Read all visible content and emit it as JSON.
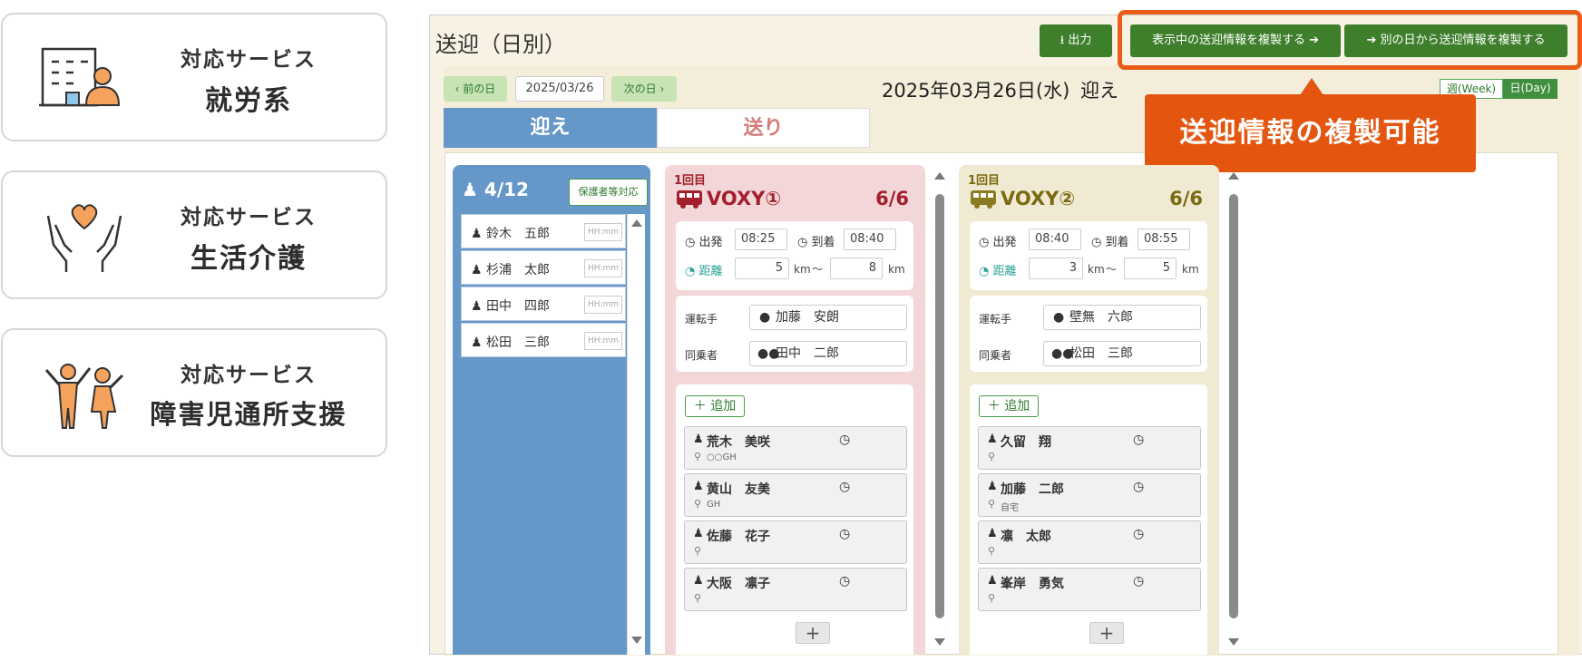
{
  "services": [
    {
      "label": "対応サービス",
      "name": "就労系",
      "icon": "office-worker-icon"
    },
    {
      "label": "対応サービス",
      "name": "生活介護",
      "icon": "care-hands-heart-icon"
    },
    {
      "label": "対応サービス",
      "name": "障害児通所支援",
      "icon": "children-icon"
    }
  ],
  "app": {
    "title": "送迎（日別）",
    "output_btn": "出力",
    "copy_current_btn": "表示中の送迎情報を複製する",
    "copy_other_btn": "別の日から送迎情報を複製する",
    "callout": "送迎情報の複製可能",
    "prev_day": "前の日",
    "next_day": "次の日",
    "date_value": "2025/03/26",
    "date_display": "2025年03月26日(水)",
    "mode_display": "迎え",
    "week_btn": "週(Week)",
    "day_btn": "日(Day)",
    "tab_pickup": "迎え",
    "tab_dropoff": "送り"
  },
  "pool": {
    "count": "4/12",
    "guardian_btn": "保護者等対応",
    "time_placeholder": "HH:mm",
    "people": [
      "鈴木　五郎",
      "杉浦　太郎",
      "田中　四郎",
      "松田　三郎"
    ]
  },
  "labels": {
    "depart": "出発",
    "arrive": "到着",
    "distance": "距離",
    "km": "km",
    "tilde": "〜",
    "driver": "運転手",
    "companion": "同乗者",
    "add": "追加",
    "plus": "+"
  },
  "vehicles": [
    {
      "round": "1回目",
      "name": "VOXY①",
      "capacity": "6/6",
      "depart": "08:25",
      "arrive": "08:40",
      "dist_from": "5",
      "dist_to": "8",
      "driver": "加藤　安朗",
      "companion": "田中　二郎",
      "riders": [
        {
          "name": "荒木　美咲",
          "place": "○○GH"
        },
        {
          "name": "黄山　友美",
          "place": "GH"
        },
        {
          "name": "佐藤　花子",
          "place": ""
        },
        {
          "name": "大阪　凛子",
          "place": ""
        }
      ]
    },
    {
      "round": "1回目",
      "name": "VOXY②",
      "capacity": "6/6",
      "depart": "08:40",
      "arrive": "08:55",
      "dist_from": "3",
      "dist_to": "5",
      "driver": "壁無　六郎",
      "companion": "松田　三郎",
      "riders": [
        {
          "name": "久留　翔",
          "place": ""
        },
        {
          "name": "加藤　二郎",
          "place": "自宅"
        },
        {
          "name": "凛　太郎",
          "place": ""
        },
        {
          "name": "峯岸　勇気",
          "place": ""
        }
      ]
    }
  ],
  "colors": {
    "green_btn": "#3e7f2c",
    "accent_orange": "#e4560f",
    "pool_blue": "#6697c9",
    "vehicle1_bg": "#f2d6d8",
    "vehicle2_bg": "#f0ead2",
    "vehicle1_text": "#a31f2c",
    "vehicle2_text": "#7a6a12"
  }
}
